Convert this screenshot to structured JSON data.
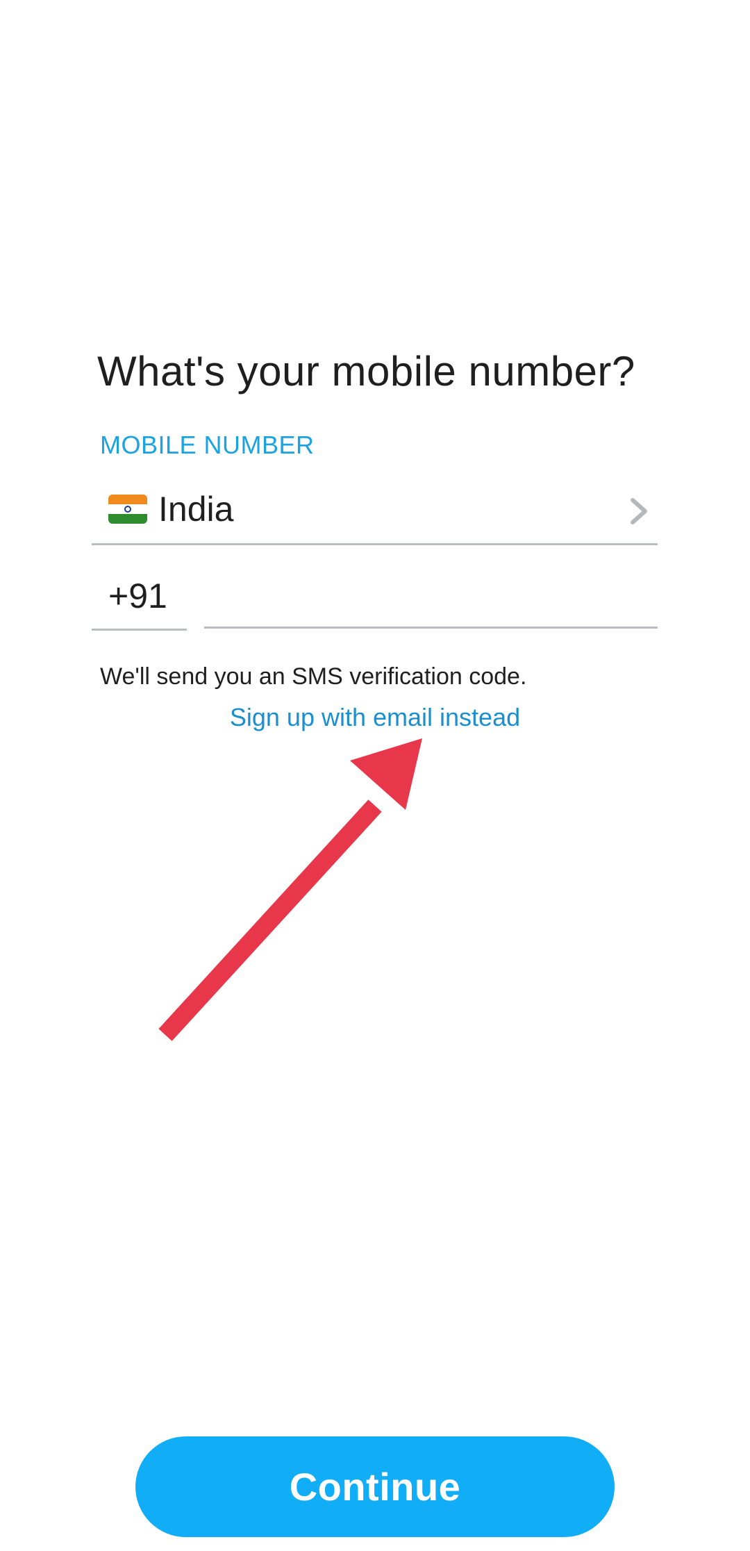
{
  "page": {
    "title": "What's your mobile number?",
    "field_label": "MOBILE NUMBER"
  },
  "country": {
    "flag_icon": "india-flag-icon",
    "name": "India",
    "chevron_icon": "chevron-right-icon"
  },
  "phone": {
    "country_code": "+91",
    "value": "",
    "placeholder": ""
  },
  "hint_text": "We'll send you an SMS verification code.",
  "email_link": "Sign up with email instead",
  "annotation": {
    "icon": "red-arrow-icon",
    "color": "#e8374a"
  },
  "continue_button": {
    "label": "Continue",
    "color": "#12adf7"
  },
  "colors": {
    "accent": "#1aa3e0",
    "link": "#1a8fcf",
    "underline": "#b9bcc0"
  }
}
